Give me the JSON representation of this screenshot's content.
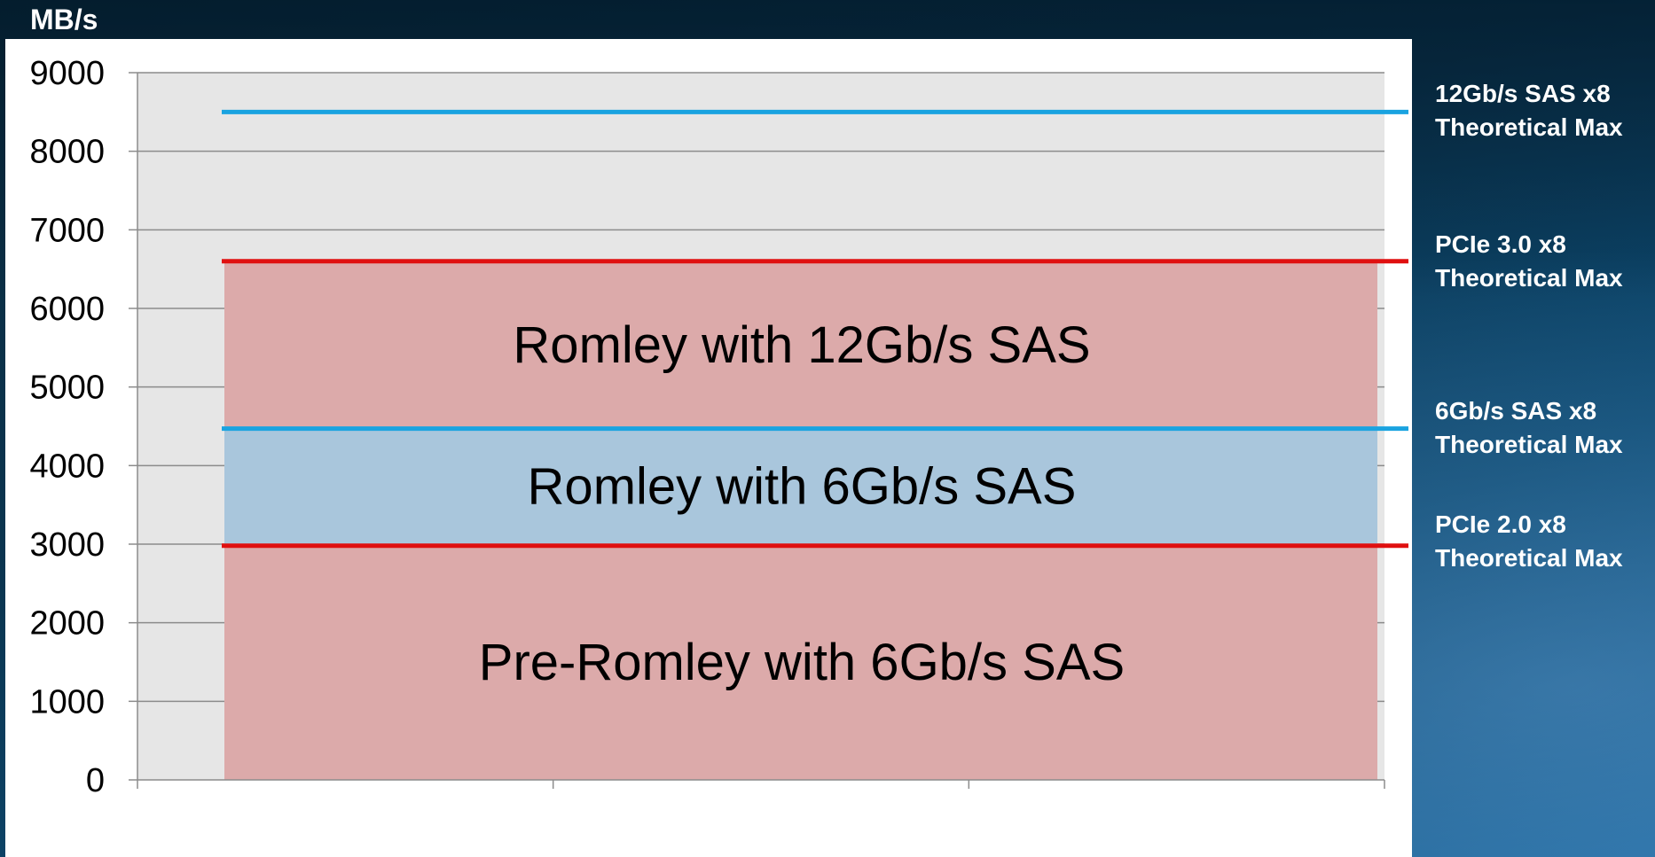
{
  "chart_data": {
    "type": "area",
    "ylabel": "MB/s",
    "ylim": [
      0,
      9000
    ],
    "yticks": [
      0,
      1000,
      2000,
      3000,
      4000,
      5000,
      6000,
      7000,
      8000,
      9000
    ],
    "grid": true,
    "plot_background": "#e6e6e6",
    "bands": [
      {
        "name": "Pre-Romley with 6Gb/s SAS",
        "from": 0,
        "to": 3000,
        "color": "#dcaaaa"
      },
      {
        "name": "Romley with 6Gb/s SAS",
        "from": 3000,
        "to": 4480,
        "color": "#a9c6dc"
      },
      {
        "name": "Romley with 12Gb/s SAS",
        "from": 4480,
        "to": 6600,
        "color": "#dcaaaa"
      }
    ],
    "reference_lines": [
      {
        "line1": "12Gb/s SAS x8",
        "line2": "Theoretical Max",
        "value": 8500,
        "color": "#1aa3e0"
      },
      {
        "line1": "PCIe 3.0 x8",
        "line2": "Theoretical Max",
        "value": 6600,
        "color": "#e01010"
      },
      {
        "line1": "6Gb/s SAS x8",
        "line2": "Theoretical Max",
        "value": 4470,
        "color": "#1aa3e0"
      },
      {
        "line1": "PCIe 2.0 x8",
        "line2": "Theoretical Max",
        "value": 2980,
        "color": "#e01010"
      }
    ]
  }
}
